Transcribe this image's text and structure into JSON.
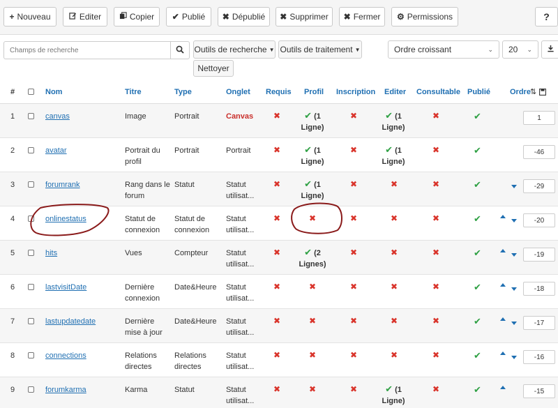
{
  "toolbar": {
    "new": "Nouveau",
    "edit": "Editer",
    "copy": "Copier",
    "publish": "Publié",
    "unpublish": "Dépublié",
    "delete": "Supprimer",
    "close": "Fermer",
    "permissions": "Permissions",
    "help": "?"
  },
  "filters": {
    "search_placeholder": "Champs de recherche",
    "search_tools": "Outils de recherche",
    "process_tools": "Outils de traitement",
    "ordering": "Ordre croissant",
    "limit": "20",
    "reset": "Nettoyer"
  },
  "columns": {
    "num": "#",
    "name": "Nom",
    "title": "Titre",
    "type": "Type",
    "tab": "Onglet",
    "required": "Requis",
    "profile": "Profil",
    "registration": "Inscription",
    "editor": "Editer",
    "viewable": "Consultable",
    "published": "Publié",
    "order": "Ordre"
  },
  "rows": [
    {
      "num": "1",
      "name": "canvas",
      "title": "Image",
      "type": "Portrait",
      "tab": "Canvas",
      "profile_count": "(1",
      "profile_unit": "Ligne)",
      "editor_count": "(1",
      "editor_unit": "Ligne)",
      "order": "1"
    },
    {
      "num": "2",
      "name": "avatar",
      "title": "Portrait du profil",
      "type": "Portrait",
      "tab": "Portrait",
      "profile_count": "(1",
      "profile_unit": "Ligne)",
      "editor_count": "(1",
      "editor_unit": "Ligne)",
      "order": "-46"
    },
    {
      "num": "3",
      "name": "forumrank",
      "title": "Rang dans le forum",
      "type": "Statut",
      "tab": "Statut utilisat...",
      "profile_count": "(1",
      "profile_unit": "Ligne)",
      "order": "-29"
    },
    {
      "num": "4",
      "name": "onlinestatus",
      "title": "Statut de connexion",
      "type": "Statut de connexion",
      "tab": "Statut utilisat...",
      "order": "-20"
    },
    {
      "num": "5",
      "name": "hits",
      "title": "Vues",
      "type": "Compteur",
      "tab": "Statut utilisat...",
      "profile_count": "(2",
      "profile_unit": "Lignes)",
      "order": "-19"
    },
    {
      "num": "6",
      "name": "lastvisitDate",
      "title": "Dernière connexion",
      "type": "Date&Heure",
      "tab": "Statut utilisat...",
      "order": "-18"
    },
    {
      "num": "7",
      "name": "lastupdatedate",
      "title": "Dernière mise à jour",
      "type": "Date&Heure",
      "tab": "Statut utilisat...",
      "order": "-17"
    },
    {
      "num": "8",
      "name": "connections",
      "title": "Relations directes",
      "type": "Relations directes",
      "tab": "Statut utilisat...",
      "order": "-16"
    },
    {
      "num": "9",
      "name": "forumkarma",
      "title": "Karma",
      "type": "Statut",
      "tab": "Statut utilisat...",
      "editor_count": "(1",
      "editor_unit": "Ligne)",
      "order": "-15"
    }
  ]
}
